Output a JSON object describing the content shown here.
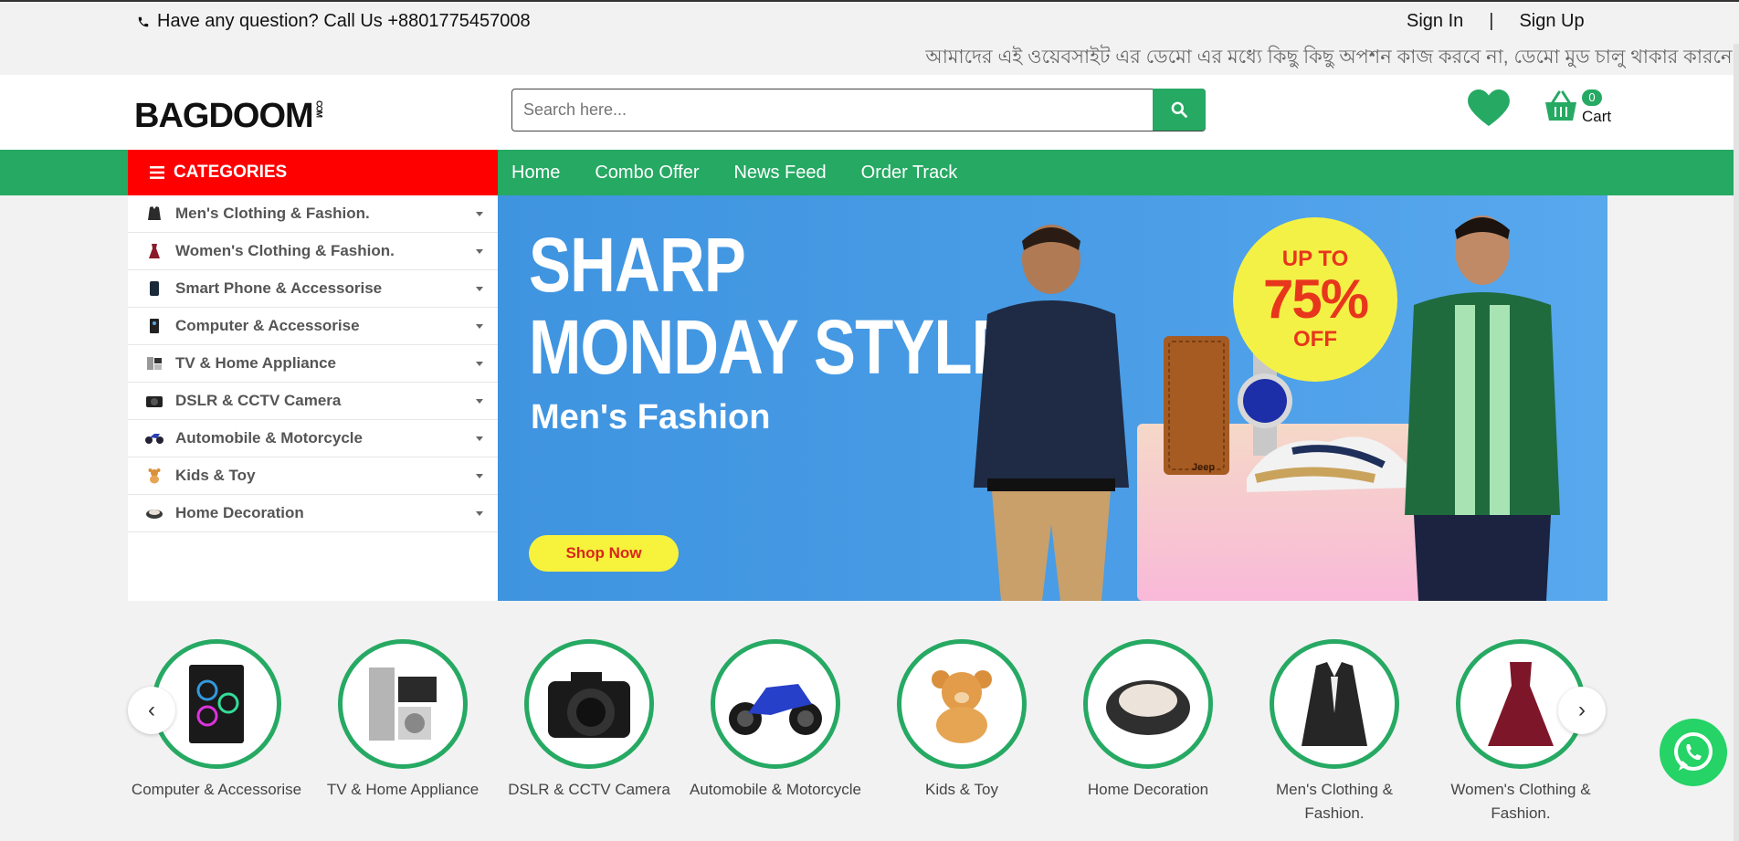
{
  "topbar": {
    "phone_text": "Have any question? Call Us +8801775457008",
    "sign_in": "Sign In",
    "separator": "|",
    "sign_up": "Sign Up",
    "notice": "আমাদের এই ওয়েবসাইট এর ডেমো এর মধ্যে কিছু কিছু অপশন কাজ করবে না, ডেমো মুড চালু থাকার কারনে।"
  },
  "header": {
    "logo_text": "BAGDOOM",
    "logo_suffix": "COM",
    "search_placeholder": "Search here...",
    "cart_count": "0",
    "cart_label": "Cart"
  },
  "nav": {
    "categories_label": "CATEGORIES",
    "links": [
      "Home",
      "Combo Offer",
      "News Feed",
      "Order Track"
    ]
  },
  "categories": [
    {
      "label": "Men's Clothing & Fashion.",
      "icon": "jacket-icon"
    },
    {
      "label": "Women's Clothing & Fashion.",
      "icon": "dress-icon"
    },
    {
      "label": "Smart Phone & Accessorise",
      "icon": "phone-icon"
    },
    {
      "label": "Computer & Accessorise",
      "icon": "computer-icon"
    },
    {
      "label": "TV & Home Appliance",
      "icon": "tv-icon"
    },
    {
      "label": "DSLR & CCTV Camera",
      "icon": "camera-icon"
    },
    {
      "label": "Automobile & Motorcycle",
      "icon": "motorcycle-icon"
    },
    {
      "label": "Kids & Toy",
      "icon": "teddy-icon"
    },
    {
      "label": "Home Decoration",
      "icon": "sofa-icon"
    }
  ],
  "banner": {
    "title_line1": "SHARP",
    "title_line2": "MONDAY STYLE",
    "subtitle": "Men's Fashion",
    "badge_top": "UP TO",
    "badge_value": "75%",
    "badge_bottom": "OFF",
    "cta": "Shop Now",
    "wallet_brand": "Jeep"
  },
  "carousel": {
    "items": [
      "Computer & Accessorise",
      "TV & Home Appliance",
      "DSLR & CCTV Camera",
      "Automobile & Motorcycle",
      "Kids & Toy",
      "Home Decoration",
      "Men's Clothing & Fashion.",
      "Women's Clothing & Fashion."
    ],
    "prev": "‹",
    "next": "›"
  },
  "colors": {
    "brand_green": "#26a963",
    "categories_red": "#ff0000",
    "banner_blue": "#4a9de6",
    "badge_yellow": "#f4f146"
  }
}
